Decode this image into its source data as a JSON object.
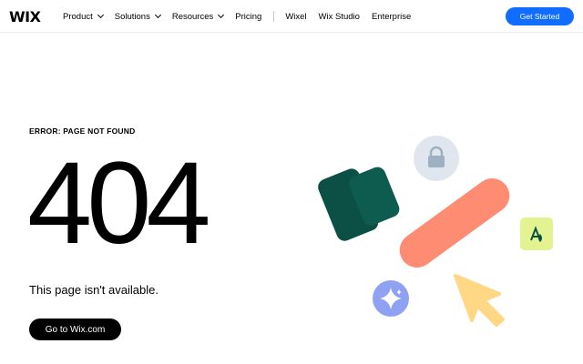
{
  "header": {
    "logo": "WIX",
    "nav": [
      {
        "label": "Product",
        "has_dropdown": true
      },
      {
        "label": "Solutions",
        "has_dropdown": true
      },
      {
        "label": "Resources",
        "has_dropdown": true
      },
      {
        "label": "Pricing",
        "has_dropdown": false
      }
    ],
    "nav_secondary": [
      "Wixel",
      "Wix Studio",
      "Enterprise"
    ],
    "cta_label": "Get Started"
  },
  "main": {
    "error_label": "ERROR: PAGE NOT FOUND",
    "code": "404",
    "message": "This page isn't available.",
    "home_button": "Go to Wix.com"
  },
  "colors": {
    "accent_blue": "#116dff",
    "bookmark_green": "#0b4f45",
    "pill_coral": "#fd8c73",
    "lock_circle": "#dfe6ee",
    "sparkle_circle": "#8fa1f2",
    "tile_lime": "#e3f38f",
    "cursor_yellow": "#ffd785"
  },
  "icons": [
    "chevron-down-icon",
    "lock-icon",
    "sparkle-icon",
    "cursor-arrow-icon",
    "text-tool-icon",
    "bookmark-shape-icon"
  ]
}
